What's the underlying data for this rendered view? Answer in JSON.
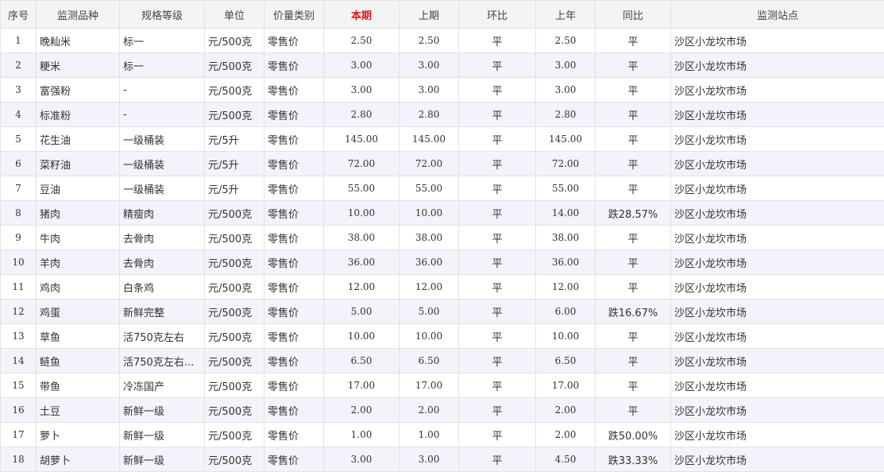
{
  "colors": {
    "header_bg": "#f4f4f4",
    "header_highlight": "#e4161c",
    "row_alt_bg": "#f4f2fb",
    "border": "#e2e2e2",
    "drop_text": "#1c8a1c"
  },
  "table": {
    "headers": [
      "序号",
      "监测品种",
      "规格等级",
      "单位",
      "价量类别",
      "本期",
      "上期",
      "环比",
      "上年",
      "同比",
      "监测站点"
    ],
    "rows": [
      [
        "1",
        "晚籼米",
        "标一",
        "元/500克",
        "零售价",
        "2.50",
        "2.50",
        "平",
        "2.50",
        "平",
        "沙区小龙坎市场"
      ],
      [
        "2",
        "粳米",
        "标一",
        "元/500克",
        "零售价",
        "3.00",
        "3.00",
        "平",
        "3.00",
        "平",
        "沙区小龙坎市场"
      ],
      [
        "3",
        "富强粉",
        "-",
        "元/500克",
        "零售价",
        "3.00",
        "3.00",
        "平",
        "3.00",
        "平",
        "沙区小龙坎市场"
      ],
      [
        "4",
        "标准粉",
        "-",
        "元/500克",
        "零售价",
        "2.80",
        "2.80",
        "平",
        "2.80",
        "平",
        "沙区小龙坎市场"
      ],
      [
        "5",
        "花生油",
        "一级桶装",
        "元/5升",
        "零售价",
        "145.00",
        "145.00",
        "平",
        "145.00",
        "平",
        "沙区小龙坎市场"
      ],
      [
        "6",
        "菜籽油",
        "一级桶装",
        "元/5升",
        "零售价",
        "72.00",
        "72.00",
        "平",
        "72.00",
        "平",
        "沙区小龙坎市场"
      ],
      [
        "7",
        "豆油",
        "一级桶装",
        "元/5升",
        "零售价",
        "55.00",
        "55.00",
        "平",
        "55.00",
        "平",
        "沙区小龙坎市场"
      ],
      [
        "8",
        "猪肉",
        "精瘦肉",
        "元/500克",
        "零售价",
        "10.00",
        "10.00",
        "平",
        "14.00",
        "跌28.57%",
        "沙区小龙坎市场"
      ],
      [
        "9",
        "牛肉",
        "去骨肉",
        "元/500克",
        "零售价",
        "38.00",
        "38.00",
        "平",
        "38.00",
        "平",
        "沙区小龙坎市场"
      ],
      [
        "10",
        "羊肉",
        "去骨肉",
        "元/500克",
        "零售价",
        "36.00",
        "36.00",
        "平",
        "36.00",
        "平",
        "沙区小龙坎市场"
      ],
      [
        "11",
        "鸡肉",
        "白条鸡",
        "元/500克",
        "零售价",
        "12.00",
        "12.00",
        "平",
        "12.00",
        "平",
        "沙区小龙坎市场"
      ],
      [
        "12",
        "鸡蛋",
        "新鲜完整",
        "元/500克",
        "零售价",
        "5.00",
        "5.00",
        "平",
        "6.00",
        "跌16.67%",
        "沙区小龙坎市场"
      ],
      [
        "13",
        "草鱼",
        "活750克左右",
        "元/500克",
        "零售价",
        "10.00",
        "10.00",
        "平",
        "10.00",
        "平",
        "沙区小龙坎市场"
      ],
      [
        "14",
        "鲢鱼",
        "活750克左右...",
        "元/500克",
        "零售价",
        "6.50",
        "6.50",
        "平",
        "6.50",
        "平",
        "沙区小龙坎市场"
      ],
      [
        "15",
        "带鱼",
        "冷冻国产",
        "元/500克",
        "零售价",
        "17.00",
        "17.00",
        "平",
        "17.00",
        "平",
        "沙区小龙坎市场"
      ],
      [
        "16",
        "土豆",
        "新鲜一级",
        "元/500克",
        "零售价",
        "2.00",
        "2.00",
        "平",
        "2.00",
        "平",
        "沙区小龙坎市场"
      ],
      [
        "17",
        "萝卜",
        "新鲜一级",
        "元/500克",
        "零售价",
        "1.00",
        "1.00",
        "平",
        "2.00",
        "跌50.00%",
        "沙区小龙坎市场"
      ],
      [
        "18",
        "胡萝卜",
        "新鲜一级",
        "元/500克",
        "零售价",
        "3.00",
        "3.00",
        "平",
        "4.50",
        "跌33.33%",
        "沙区小龙坎市场"
      ]
    ]
  }
}
